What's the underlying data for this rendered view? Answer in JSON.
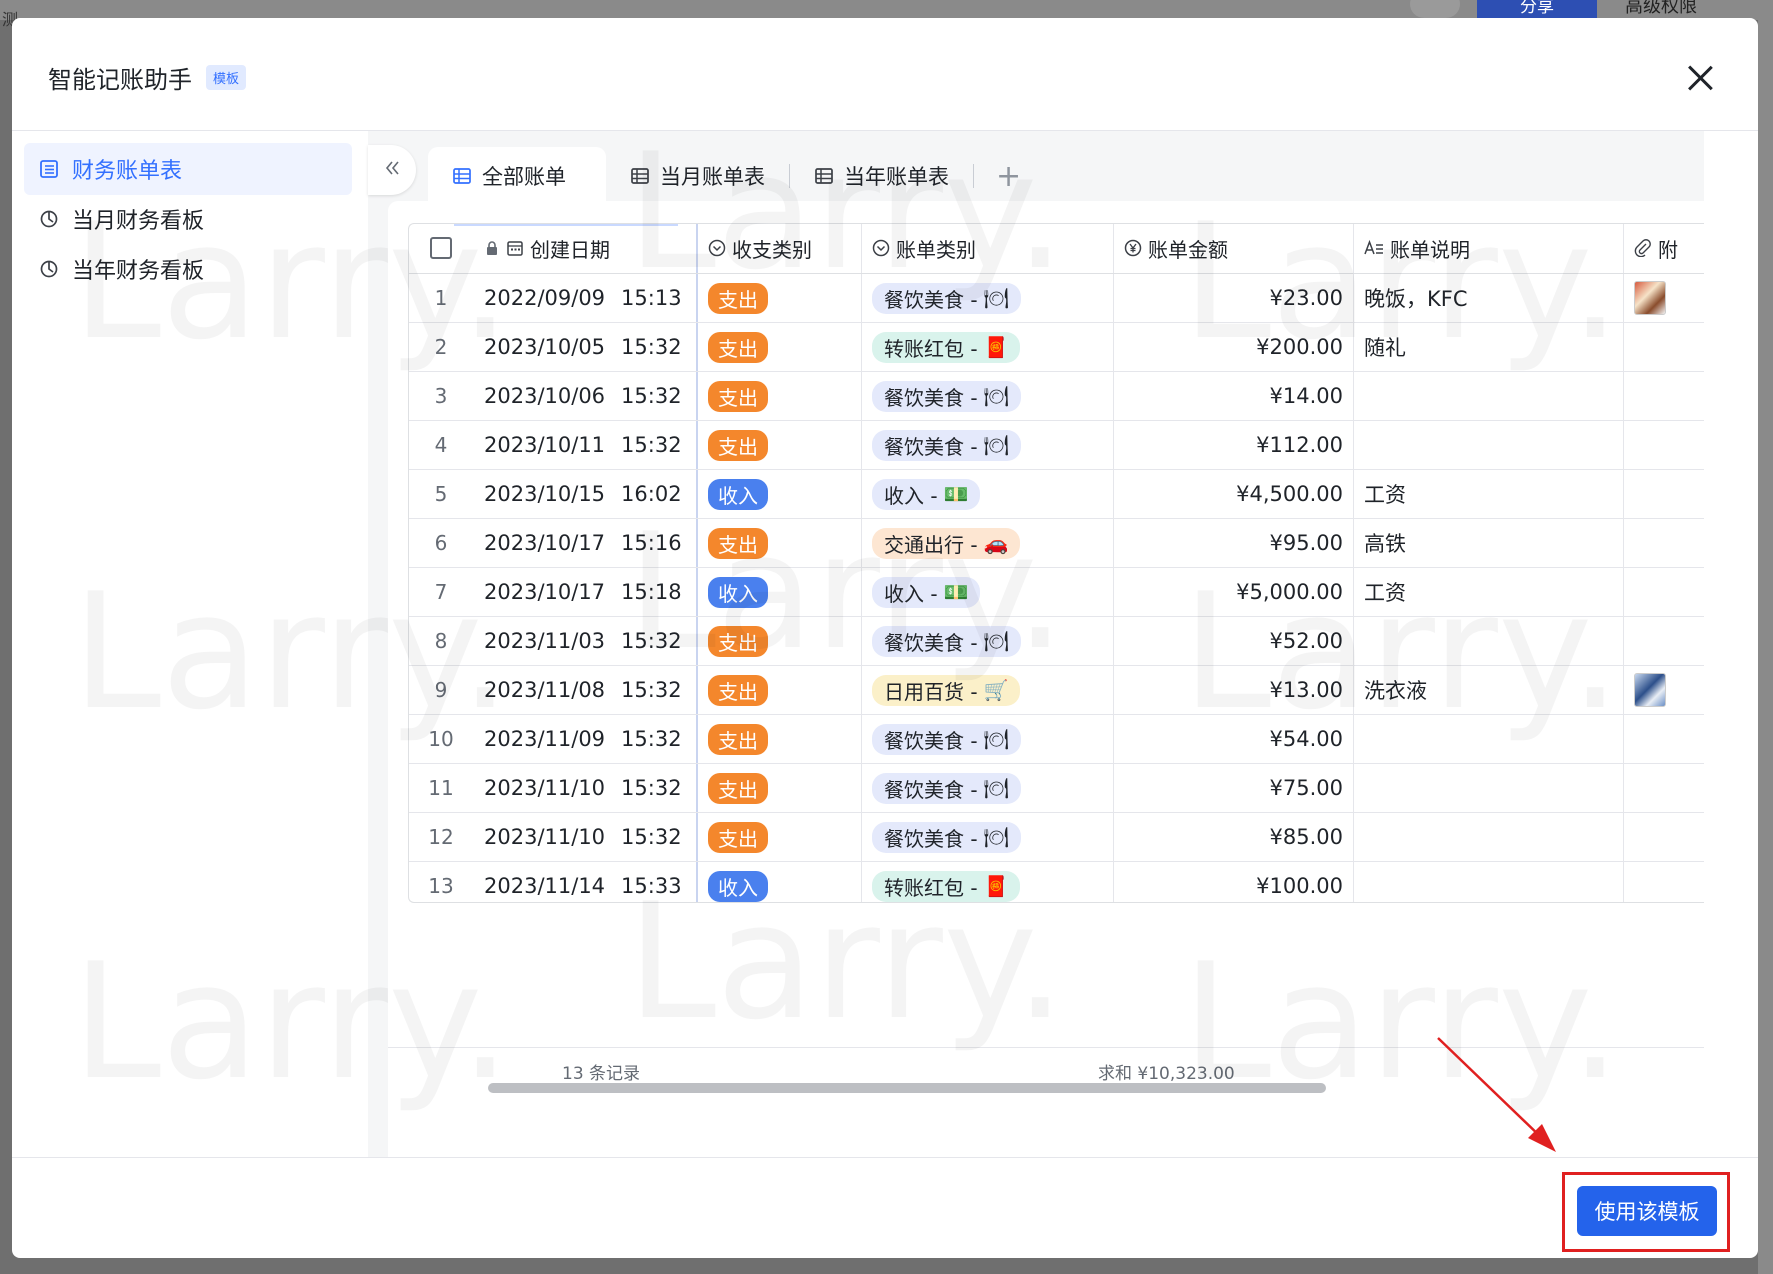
{
  "background": {
    "left_text": "测",
    "share_label": "分享",
    "advanced_label": "高级权限"
  },
  "dialog": {
    "title": "智能记账助手",
    "badge": "模板",
    "use_button": "使用该模板"
  },
  "sidebar": {
    "items": [
      {
        "label": "财务账单表",
        "icon": "table-icon",
        "active": true
      },
      {
        "label": "当月财务看板",
        "icon": "dashboard-icon",
        "active": false
      },
      {
        "label": "当年财务看板",
        "icon": "dashboard-icon",
        "active": false
      }
    ]
  },
  "tabs": [
    {
      "label": "全部账单",
      "active": true
    },
    {
      "label": "当月账单表",
      "active": false
    },
    {
      "label": "当年账单表",
      "active": false
    }
  ],
  "table": {
    "headers": {
      "date": "创建日期",
      "type": "收支类别",
      "category": "账单类别",
      "amount": "账单金额",
      "desc": "账单说明",
      "attachment": "附"
    },
    "rows": [
      {
        "idx": "1",
        "date": "2022/09/09",
        "time": "15:13",
        "type": "支出",
        "cat": "餐饮美食 -",
        "emoji": "🍽",
        "amount": "¥23.00",
        "desc": "晚饭，KFC",
        "attach": "a"
      },
      {
        "idx": "2",
        "date": "2023/10/05",
        "time": "15:32",
        "type": "支出",
        "cat": "转账红包 -",
        "emoji": "🧧",
        "amount": "¥200.00",
        "desc": "随礼",
        "attach": ""
      },
      {
        "idx": "3",
        "date": "2023/10/06",
        "time": "15:32",
        "type": "支出",
        "cat": "餐饮美食 -",
        "emoji": "🍽",
        "amount": "¥14.00",
        "desc": "",
        "attach": ""
      },
      {
        "idx": "4",
        "date": "2023/10/11",
        "time": "15:32",
        "type": "支出",
        "cat": "餐饮美食 -",
        "emoji": "🍽",
        "amount": "¥112.00",
        "desc": "",
        "attach": ""
      },
      {
        "idx": "5",
        "date": "2023/10/15",
        "time": "16:02",
        "type": "收入",
        "cat": "收入 -",
        "emoji": "💵",
        "amount": "¥4,500.00",
        "desc": "工资",
        "attach": ""
      },
      {
        "idx": "6",
        "date": "2023/10/17",
        "time": "15:16",
        "type": "支出",
        "cat": "交通出行 -",
        "emoji": "🚗",
        "amount": "¥95.00",
        "desc": "高铁",
        "attach": ""
      },
      {
        "idx": "7",
        "date": "2023/10/17",
        "time": "15:18",
        "type": "收入",
        "cat": "收入 -",
        "emoji": "💵",
        "amount": "¥5,000.00",
        "desc": "工资",
        "attach": ""
      },
      {
        "idx": "8",
        "date": "2023/11/03",
        "time": "15:32",
        "type": "支出",
        "cat": "餐饮美食 -",
        "emoji": "🍽",
        "amount": "¥52.00",
        "desc": "",
        "attach": ""
      },
      {
        "idx": "9",
        "date": "2023/11/08",
        "time": "15:32",
        "type": "支出",
        "cat": "日用百货 -",
        "emoji": "🛒",
        "amount": "¥13.00",
        "desc": "洗衣液",
        "attach": "b"
      },
      {
        "idx": "10",
        "date": "2023/11/09",
        "time": "15:32",
        "type": "支出",
        "cat": "餐饮美食 -",
        "emoji": "🍽",
        "amount": "¥54.00",
        "desc": "",
        "attach": ""
      },
      {
        "idx": "11",
        "date": "2023/11/10",
        "time": "15:32",
        "type": "支出",
        "cat": "餐饮美食 -",
        "emoji": "🍽",
        "amount": "¥75.00",
        "desc": "",
        "attach": ""
      },
      {
        "idx": "12",
        "date": "2023/11/10",
        "time": "15:32",
        "type": "支出",
        "cat": "餐饮美食 -",
        "emoji": "🍽",
        "amount": "¥85.00",
        "desc": "",
        "attach": ""
      },
      {
        "idx": "13",
        "date": "2023/11/14",
        "time": "15:33",
        "type": "收入",
        "cat": "转账红包 -",
        "emoji": "🧧",
        "amount": "¥100.00",
        "desc": "",
        "attach": ""
      }
    ],
    "footer": {
      "count": "13 条记录",
      "sum": "求和 ¥10,323.00"
    }
  },
  "watermark": "Larry.",
  "colors": {
    "accent": "#3370ff",
    "expense": "#f4872c",
    "income": "#4a80ee",
    "button": "#2463eb",
    "highlight_box": "#e02020"
  }
}
